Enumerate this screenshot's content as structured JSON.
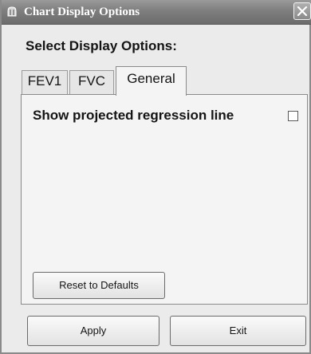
{
  "window": {
    "title": "Chart Display Options"
  },
  "heading": "Select Display Options:",
  "tabs": [
    {
      "label": "FEV1",
      "active": false
    },
    {
      "label": "FVC",
      "active": false
    },
    {
      "label": "General",
      "active": true
    }
  ],
  "general": {
    "option_label": "Show projected regression line",
    "option_checked": false,
    "reset_label": "Reset to Defaults"
  },
  "footer": {
    "apply_label": "Apply",
    "exit_label": "Exit"
  },
  "icons": {
    "title": "app-icon",
    "close": "close-icon"
  }
}
